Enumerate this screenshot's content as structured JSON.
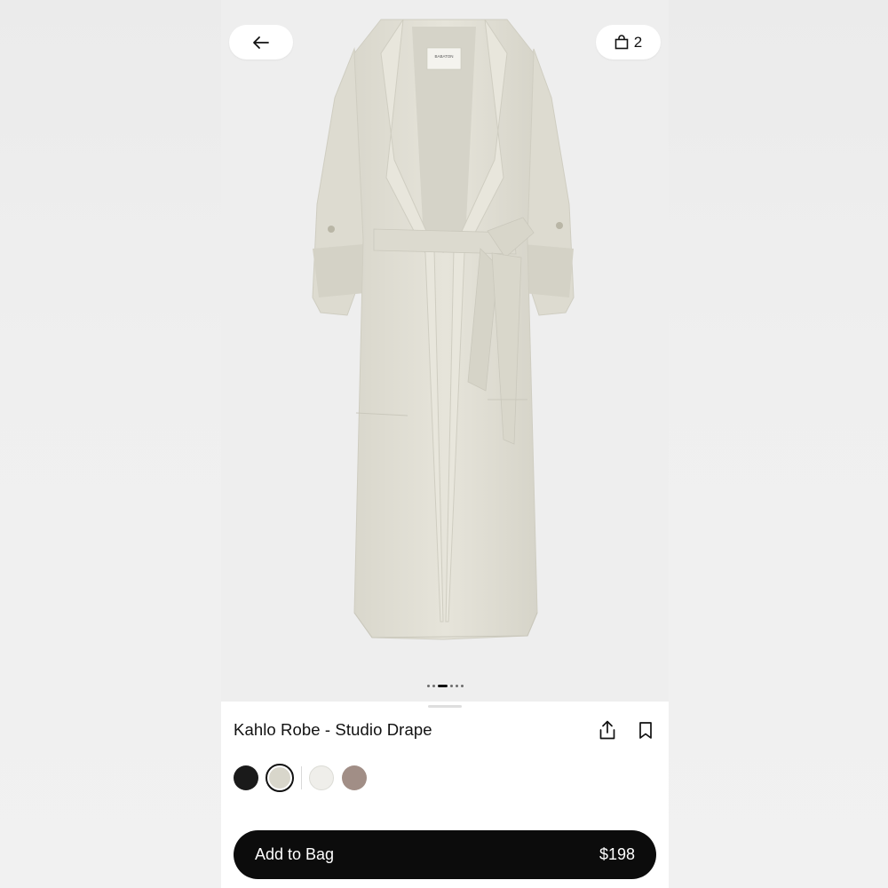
{
  "header": {
    "back_icon": "arrow-left-icon",
    "bag_icon": "shopping-bag-icon",
    "bag_count": "2"
  },
  "gallery": {
    "total_images": 6,
    "active_index": 2,
    "tag_text": "BABATON"
  },
  "product": {
    "title": "Kahlo Robe - Studio Drape",
    "share_icon": "share-icon",
    "save_icon": "bookmark-icon"
  },
  "colors": {
    "swatches": [
      {
        "name": "black",
        "hex": "#1a1a1a",
        "selected": false
      },
      {
        "name": "stone",
        "hex": "#d8d6cb",
        "selected": true
      },
      {
        "name": "white",
        "hex": "#efeeea",
        "selected": false
      },
      {
        "name": "taupe",
        "hex": "#a18e86",
        "selected": false
      }
    ]
  },
  "cta": {
    "label": "Add to Bag",
    "price": "$198"
  },
  "theme": {
    "accent": "#0c0c0c",
    "hero_bg": "#eeeeee",
    "robe_color": "#e2e0d6"
  }
}
